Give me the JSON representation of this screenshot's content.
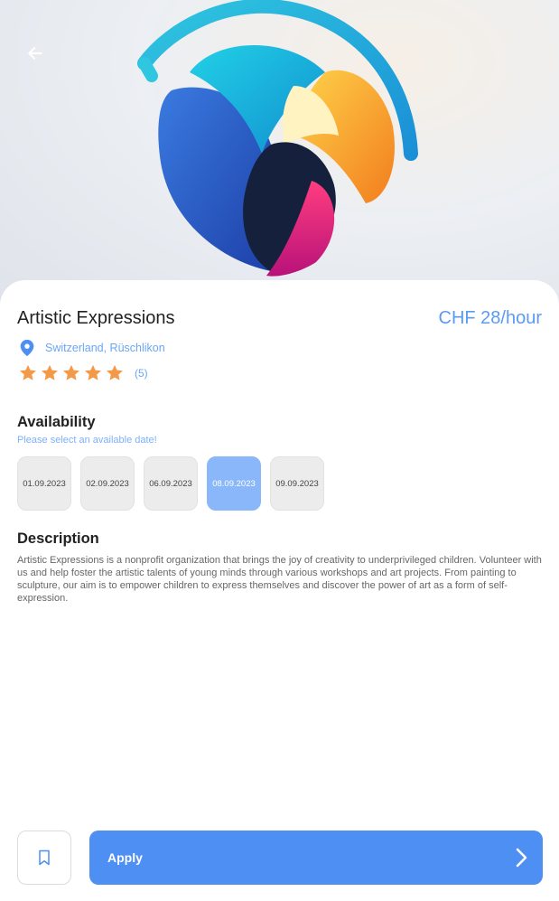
{
  "colors": {
    "accent": "#4e8ff4",
    "price": "#5b9bf3",
    "star": "#f2994a",
    "selected_date": "#8ab6fa"
  },
  "header": {
    "back_icon": "arrow-left-icon"
  },
  "listing": {
    "title": "Artistic Expressions",
    "price": "CHF 28/hour",
    "location": "Switzerland, Rüschlikon",
    "rating": 5,
    "rating_count": "(5)"
  },
  "availability": {
    "title": "Availability",
    "subtitle": "Please select an available date!",
    "dates": [
      "01.09.2023",
      "02.09.2023",
      "06.09.2023",
      "08.09.2023",
      "09.09.2023"
    ],
    "selected": "08.09.2023"
  },
  "description": {
    "title": "Description",
    "text": "Artistic Expressions is a nonprofit organization that brings the joy of creativity to underprivileged children. Volunteer with us and help foster the artistic talents of young minds through various workshops and art projects. From painting to sculpture, our aim is to empower children to express themselves and discover the power of art as a form of self-expression."
  },
  "footer": {
    "bookmark_icon": "bookmark-icon",
    "apply_label": "Apply",
    "apply_icon": "chevron-right-icon"
  }
}
